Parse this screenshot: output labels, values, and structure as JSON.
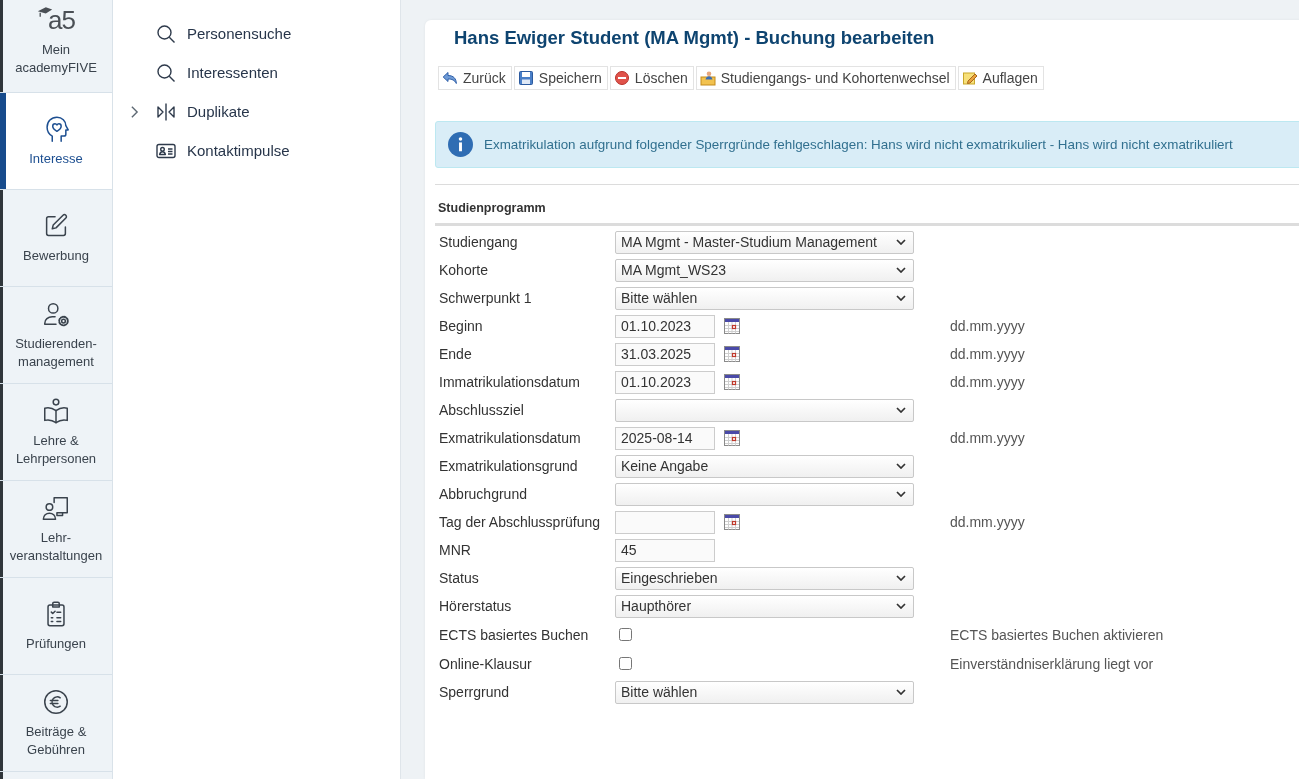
{
  "sidebar": {
    "logo_text": "a5",
    "items": [
      {
        "label": "Mein academyFIVE",
        "selected": false
      },
      {
        "label": "Interesse",
        "selected": true
      },
      {
        "label": "Bewerbung",
        "selected": false
      },
      {
        "label": "Studierenden-management",
        "selected": false
      },
      {
        "label": "Lehre & Lehrpersonen",
        "selected": false
      },
      {
        "label": "Lehr-veranstaltungen",
        "selected": false
      },
      {
        "label": "Prüfungen",
        "selected": false
      },
      {
        "label": "Beiträge & Gebühren",
        "selected": false
      }
    ]
  },
  "subnav": {
    "items": [
      {
        "label": "Personensuche",
        "expandable": false
      },
      {
        "label": "Interessenten",
        "expandable": false
      },
      {
        "label": "Duplikate",
        "expandable": true
      },
      {
        "label": "Kontaktimpulse",
        "expandable": false
      }
    ]
  },
  "page": {
    "title": "Hans Ewiger Student (MA Mgmt) - Buchung bearbeiten",
    "toolbar": [
      "Zurück",
      "Speichern",
      "Löschen",
      "Studiengangs- und Kohortenwechsel",
      "Auflagen"
    ],
    "message": "Exmatrikulation aufgrund folgender Sperrgründe fehlgeschlagen: Hans wird nicht exmatrikuliert - Hans wird nicht exmatrikuliert",
    "section_title": "Studienprogramm",
    "fields": [
      {
        "kind": "select",
        "label": "Studiengang",
        "value": "MA Mgmt - Master-Studium Management"
      },
      {
        "kind": "select",
        "label": "Kohorte",
        "value": "MA Mgmt_WS23"
      },
      {
        "kind": "select",
        "label": "Schwerpunkt 1",
        "value": "Bitte wählen"
      },
      {
        "kind": "date",
        "label": "Beginn",
        "value": "01.10.2023",
        "hint": "dd.mm.yyyy"
      },
      {
        "kind": "date",
        "label": "Ende",
        "value": "31.03.2025",
        "hint": "dd.mm.yyyy"
      },
      {
        "kind": "date",
        "label": "Immatrikulationsdatum",
        "value": "01.10.2023",
        "hint": "dd.mm.yyyy"
      },
      {
        "kind": "select",
        "label": "Abschlussziel"
      },
      {
        "kind": "date",
        "label": "Exmatrikulationsdatum",
        "value": "2025-08-14",
        "hint": "dd.mm.yyyy"
      },
      {
        "kind": "select",
        "label": "Exmatrikulationsgrund",
        "value": "Keine Angabe"
      },
      {
        "kind": "select",
        "label": "Abbruchgrund"
      },
      {
        "kind": "date",
        "label": "Tag der Abschlussprüfung",
        "hint": "dd.mm.yyyy"
      },
      {
        "kind": "text",
        "label": "MNR",
        "value": "45"
      },
      {
        "kind": "select",
        "label": "Status",
        "value": "Eingeschrieben"
      },
      {
        "kind": "select",
        "label": "Hörerstatus",
        "value": "Haupthörer"
      },
      {
        "kind": "checkbox",
        "label": "ECTS basiertes Buchen",
        "checked": false,
        "hint": "ECTS basiertes Buchen aktivieren"
      },
      {
        "kind": "checkbox",
        "label": "Online-Klausur",
        "checked": false,
        "hint": "Einverständniserklärung liegt vor"
      },
      {
        "kind": "select",
        "label": "Sperrgrund",
        "value": "Bitte wählen"
      }
    ]
  }
}
